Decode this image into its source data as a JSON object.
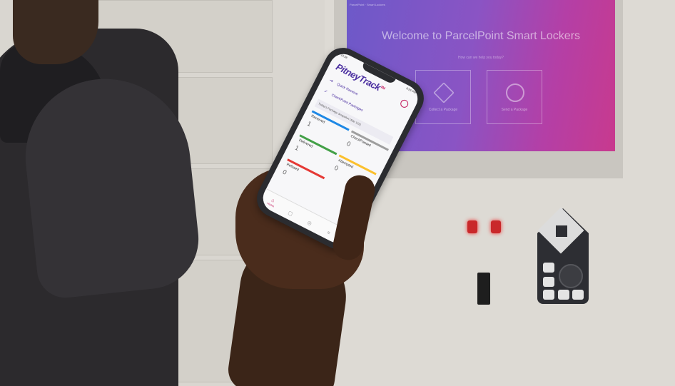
{
  "kiosk": {
    "status": "ParcelPoint · Smart Lockers",
    "title": "Welcome to ParcelPoint Smart Lockers",
    "subtitle": "How can we help you today?",
    "tiles": [
      {
        "label": "Collect a Package"
      },
      {
        "label": "Send a Package"
      }
    ]
  },
  "phone": {
    "time": "10:38",
    "battery": "8:23 PM",
    "brand": "PitneyTrack",
    "brand_tm": "TM",
    "menu": [
      {
        "label": "Quick Receive",
        "icon": "receive-icon"
      },
      {
        "label": "CheckPoint Packages",
        "icon": "check-icon"
      }
    ],
    "snapshot_label": "Today's Package Snapshot (Site 123)",
    "stats": [
      {
        "label": "Received",
        "value": "1",
        "color": "#1e88e5"
      },
      {
        "label": "CheckPointed",
        "value": "0",
        "color": "#9e9e9e"
      },
      {
        "label": "Delivered",
        "value": "1",
        "color": "#43a047"
      },
      {
        "label": "Attempted",
        "value": "0",
        "color": "#fbc02d"
      },
      {
        "label": "Refused",
        "value": "0",
        "color": "#e53935"
      }
    ],
    "tabs": [
      {
        "label": "Home",
        "icon": "home-icon"
      },
      {
        "label": "",
        "icon": "package-icon"
      },
      {
        "label": "",
        "icon": "location-icon"
      },
      {
        "label": "",
        "icon": "menu-icon"
      }
    ]
  },
  "colors": {
    "brand_purple": "#4b2fa0",
    "accent_pink": "#c2185b",
    "kiosk_gradient_start": "#6d59c9",
    "kiosk_gradient_end": "#c83a8e"
  }
}
